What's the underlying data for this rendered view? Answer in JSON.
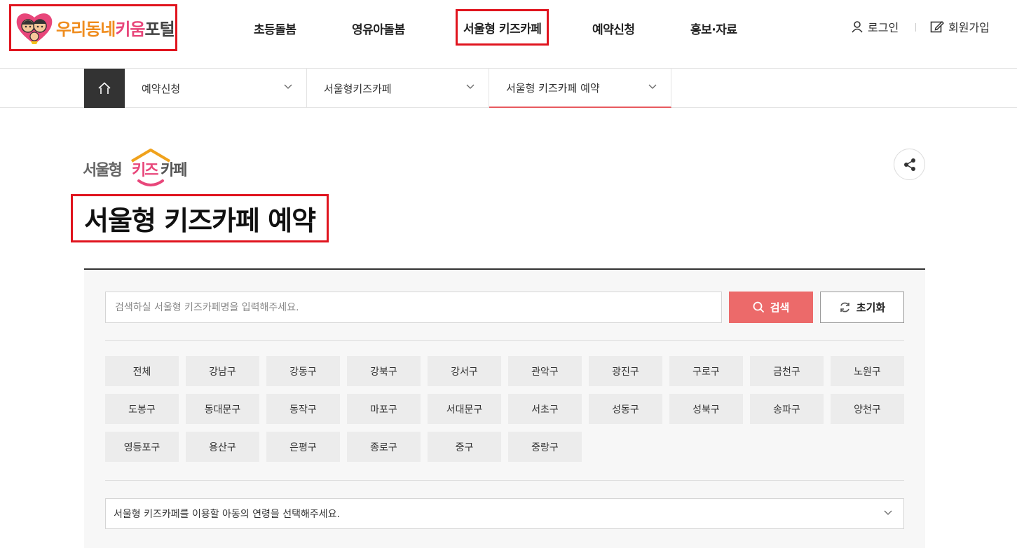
{
  "header": {
    "logo_text_part1": "우리동네",
    "logo_text_part2": "키움",
    "logo_text_part3": "포털",
    "nav": [
      {
        "label": "초등돌봄"
      },
      {
        "label": "영유아돌봄"
      },
      {
        "label": "서울형 키즈카페"
      },
      {
        "label": "예약신청"
      },
      {
        "label": "홍보·자료"
      }
    ],
    "login_label": "로그인",
    "signup_label": "회원가입"
  },
  "breadcrumb": {
    "items": [
      {
        "label": "예약신청"
      },
      {
        "label": "서울형키즈카페"
      },
      {
        "label": "서울형 키즈카페 예약"
      }
    ]
  },
  "page": {
    "brand_logo_text": "서울형키즈카페",
    "title": "서울형 키즈카페 예약"
  },
  "search": {
    "placeholder": "검색하실 서울형 키즈카페명을 입력해주세요.",
    "search_label": "검색",
    "reset_label": "초기화"
  },
  "districts": [
    "전체",
    "강남구",
    "강동구",
    "강북구",
    "강서구",
    "관악구",
    "광진구",
    "구로구",
    "금천구",
    "노원구",
    "도봉구",
    "동대문구",
    "동작구",
    "마포구",
    "서대문구",
    "서초구",
    "성동구",
    "성북구",
    "송파구",
    "양천구",
    "영등포구",
    "용산구",
    "은평구",
    "종로구",
    "중구",
    "중랑구"
  ],
  "age_select": {
    "value": "서울형 키즈카페를 이용할 아동의 연령을 선택해주세요."
  },
  "colors": {
    "accent": "#ec6a6a",
    "highlight_box": "#e0141e",
    "home_bg": "#333333",
    "logo_orange": "#ef8c1d",
    "logo_pink": "#e8467a"
  }
}
